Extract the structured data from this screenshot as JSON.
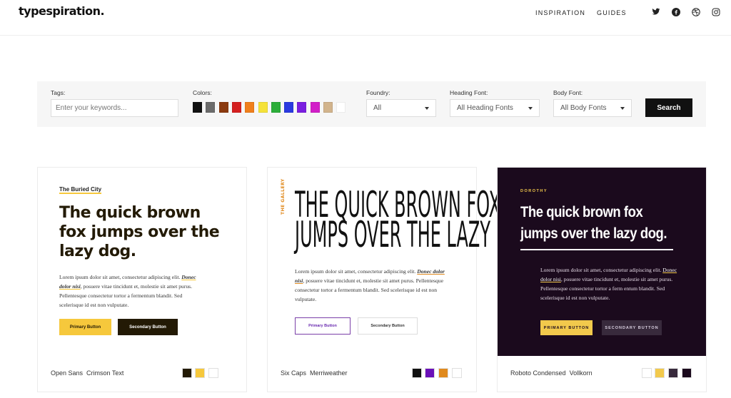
{
  "header": {
    "logo": "typespiration",
    "logo_dot": ".",
    "nav": [
      "INSPIRATION",
      "GUIDES"
    ],
    "social_icons": [
      "twitter-icon",
      "facebook-icon",
      "dribbble-icon",
      "instagram-icon"
    ]
  },
  "filters": {
    "tags_label": "Tags:",
    "tags_placeholder": "Enter your keywords...",
    "colors_label": "Colors:",
    "colors": [
      "#111111",
      "#6b6b6b",
      "#8b3a0f",
      "#d42020",
      "#f07f1c",
      "#f5e23a",
      "#2cae3a",
      "#2a3ae0",
      "#7a1fe0",
      "#d21fc8",
      "#d2b48c",
      "#ffffff"
    ],
    "foundry_label": "Foundry:",
    "foundry_value": "All",
    "heading_label": "Heading Font:",
    "heading_value": "All Heading Fonts",
    "body_label": "Body Font:",
    "body_value": "All Body Fonts",
    "search_label": "Search"
  },
  "cards": [
    {
      "kicker": "The Buried City",
      "title": "The quick brown fox jumps over the lazy dog.",
      "body_line1": "Lorem ipsum dolor sit amet, consectetur adipiscing elit.",
      "body_highlight": "Donec dolor nisi",
      "body_rest": ", posuere vitae tincidunt et, molestie sit amet purus. Pellentesque consectetur tortor a fermentum blandit. Sed scelerisque id est non vulputate.",
      "primary_button": "Primary Button",
      "secondary_button": "Secondary Button",
      "heading_font": "Open Sans",
      "body_font": "Crimson Text",
      "palette": [
        "#231a05",
        "#f6c83c",
        "#ffffff"
      ]
    },
    {
      "kicker": "THE GALLERY",
      "title_line1": "THE QUICK BROWN FOX",
      "title_line2": "JUMPS OVER THE LAZY DOG.",
      "body_line1": "Lorem ipsum dolor sit amet, consectetur adipiscing elit.",
      "body_highlight": "Donec dolor nisi",
      "body_rest": ", posuere vitae tincidunt et, molestie sit amet purus. Pellentesque consectetur tortor a fermentum blandit. Sed scelerisque id est non vulputate.",
      "primary_button": "Primary Button",
      "secondary_button": "Secondary Button",
      "heading_font": "Six Caps",
      "body_font": "Merriweather",
      "palette": [
        "#111111",
        "#6a10b8",
        "#e08a1e",
        "#ffffff"
      ]
    },
    {
      "kicker": "DOROTHY",
      "title_line1": "The quick brown fox",
      "title_line2": "jumps over the lazy dog.",
      "body_line1": "Lorem ipsum dolor sit amet, consectetur adipiscing elit.",
      "body_highlight": "Donec dolor nisi",
      "body_rest": ", posuere vitae tincidunt et, molestie sit amet purus. Pellentesque consectetur tortor a ferm entum blandit. Sed scelerisque id est non vulputate.",
      "primary_button": "PRIMARY BUTTON",
      "secondary_button": "SECONDARY BUTTON",
      "heading_font": "Roboto Condensed",
      "body_font": "Vollkorn",
      "palette": [
        "#ffffff",
        "#f2c94c",
        "#382a3c",
        "#1b0a1d"
      ]
    }
  ]
}
